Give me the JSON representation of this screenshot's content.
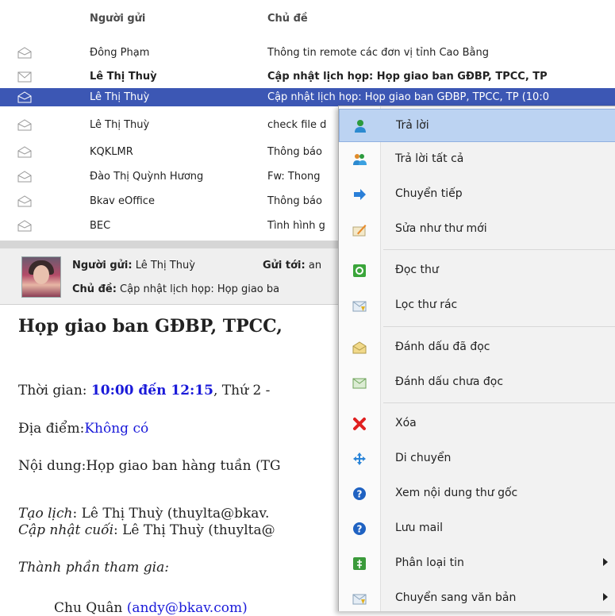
{
  "list": {
    "header": {
      "sender": "Người gửi",
      "subject": "Chủ đề"
    },
    "rows": [
      {
        "sender": "Đông Phạm",
        "subject": "Thông tin remote các đơn vị tỉnh Cao Bằng"
      },
      {
        "sender": "Lê Thị Thuỳ",
        "subject": "Cập nhật lịch họp: Họp giao ban GĐBP, TPCC, TP"
      },
      {
        "sender": "Lê Thị Thuỳ",
        "subject": "Cập nhật lịch họp: Họp giao ban GĐBP, TPCC, TP (10:0"
      },
      {
        "sender": "Lê Thị Thuỳ",
        "subject": "check file d"
      },
      {
        "sender": "KQKLMR",
        "subject": "Thông báo"
      },
      {
        "sender": "Đào Thị Quỳnh Hương",
        "subject": "Fw: Thong"
      },
      {
        "sender": "Bkav eOffice",
        "subject": "Thông báo"
      },
      {
        "sender": "BEC",
        "subject": "Tình hình g"
      }
    ]
  },
  "reading_pane": {
    "from_label": "Người gửi:",
    "from_value": " Lê Thị Thuỳ",
    "to_label": "Gửi tới:",
    "to_value": " an",
    "subject_label": "Chủ đề:",
    "subject_value": " Cập nhật lịch họp: Họp giao ba"
  },
  "body": {
    "title": "Họp giao ban GĐBP, TPCC,",
    "time_label": "Thời gian: ",
    "time_value": "10:00 đến 12:15",
    "time_rest": ", Thứ 2 -",
    "place_label": "Địa điểm:",
    "place_value": "Không có",
    "content": "Nội dung:Họp giao ban hàng tuần (TG",
    "created_label": "Tạo lịch",
    "created_value": ": Lê Thị Thuỳ (thuylta@bkav.",
    "updated_label": "Cập nhật cuối",
    "updated_value": ": Lê Thị Thuỳ (thuylta@",
    "participants_label": "Thành phần tham gia:",
    "participant_first": "Chu Quân",
    "participant_email": "(andy@bkav.com)"
  },
  "menu": {
    "items": [
      {
        "label": "Trả lời",
        "icon": "reply-icon"
      },
      {
        "label": "Trả lời tất cả",
        "icon": "reply-all-icon"
      },
      {
        "label": "Chuyển tiếp",
        "icon": "forward-icon"
      },
      {
        "label": "Sửa như thư mới",
        "icon": "edit-as-new-icon"
      },
      {
        "label": "Đọc thư",
        "icon": "read-mail-icon"
      },
      {
        "label": "Lọc thư rác",
        "icon": "spam-filter-icon"
      },
      {
        "label": "Đánh dấu đã đọc",
        "icon": "mark-read-icon"
      },
      {
        "label": "Đánh dấu chưa đọc",
        "icon": "mark-unread-icon"
      },
      {
        "label": "Xóa",
        "icon": "delete-icon"
      },
      {
        "label": "Di chuyển",
        "icon": "move-icon"
      },
      {
        "label": "Xem nội dung thư gốc",
        "icon": "help-icon"
      },
      {
        "label": "Lưu mail",
        "icon": "help-icon"
      },
      {
        "label": "Phân loại tin",
        "icon": "categorize-icon"
      },
      {
        "label": "Chuyển sang văn bản",
        "icon": "convert-document-icon"
      }
    ]
  },
  "colors": {
    "selected_row": "#3c57b4",
    "menu_highlight": "#bcd3f2",
    "link_blue": "#1a1ad9"
  }
}
